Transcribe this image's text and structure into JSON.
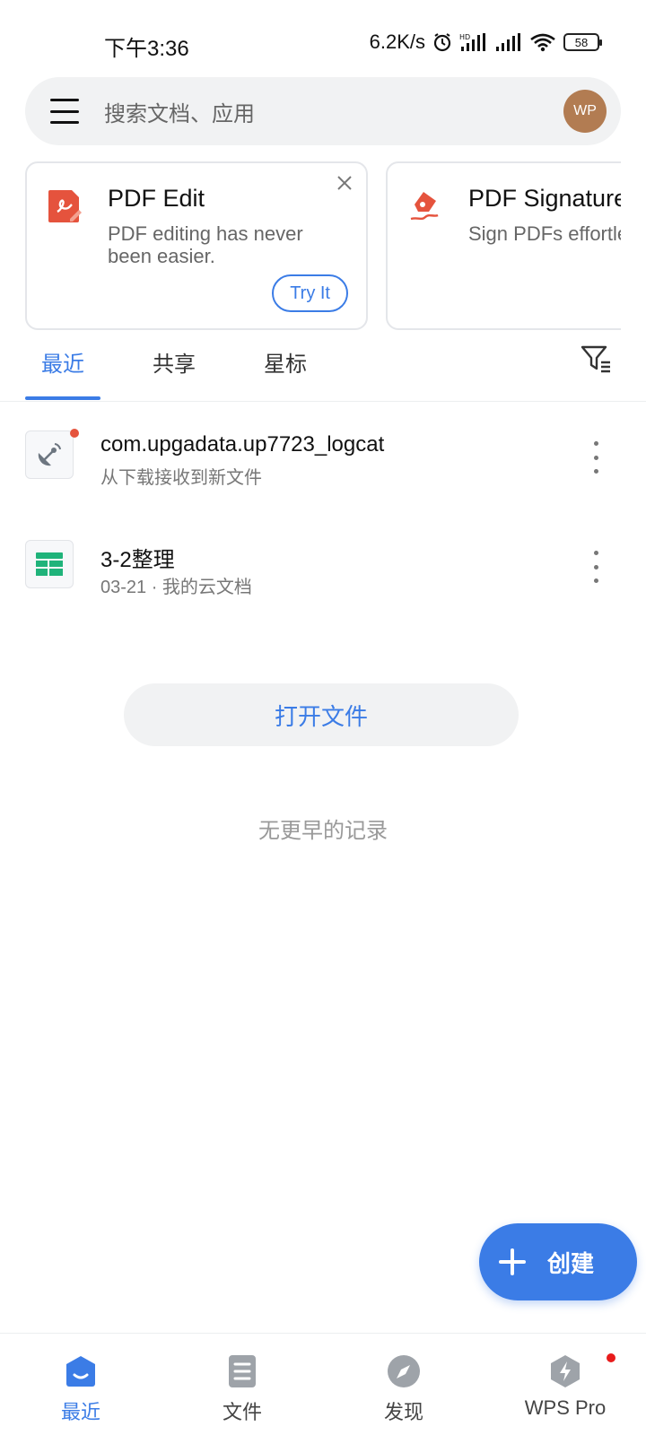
{
  "status_bar": {
    "time": "下午3:36",
    "network_speed": "6.2K/s",
    "battery": "58",
    "icons": [
      "alarm-icon",
      "hd-signal-icon",
      "signal-icon",
      "wifi-icon",
      "battery-icon"
    ]
  },
  "search": {
    "placeholder": "搜索文档、应用",
    "avatar_initials": "WP"
  },
  "promos": [
    {
      "title": "PDF Edit",
      "description": "PDF editing has never been easier.",
      "button": "Try It",
      "icon": "pdf-edit-icon"
    },
    {
      "title": "PDF Signature",
      "description": "Sign PDFs effortlessly",
      "icon": "pdf-signature-icon"
    }
  ],
  "tabs": [
    {
      "label": "最近",
      "active": true
    },
    {
      "label": "共享",
      "active": false
    },
    {
      "label": "星标",
      "active": false
    }
  ],
  "files": [
    {
      "name": "com.upgadata.up7723_logcat",
      "meta": "从下载接收到新文件",
      "icon": "satellite-file-icon",
      "unread": true
    },
    {
      "name": "3-2整理",
      "meta": "03-21 · 我的云文档",
      "icon": "spreadsheet-icon",
      "unread": false
    }
  ],
  "open_file_label": "打开文件",
  "no_more_label": "无更早的记录",
  "fab_label": "创建",
  "bottom_nav": [
    {
      "label": "最近",
      "icon": "home-icon",
      "active": true
    },
    {
      "label": "文件",
      "icon": "document-icon",
      "active": false
    },
    {
      "label": "发现",
      "icon": "compass-icon",
      "active": false
    },
    {
      "label": "WPS Pro",
      "icon": "wps-pro-icon",
      "active": false,
      "badge": true
    }
  ],
  "colors": {
    "accent": "#3b7ce6",
    "pdf_red": "#e5533d",
    "sheet_green": "#1fb37a",
    "avatar": "#b27c52",
    "badge_red": "#e81b1b"
  }
}
